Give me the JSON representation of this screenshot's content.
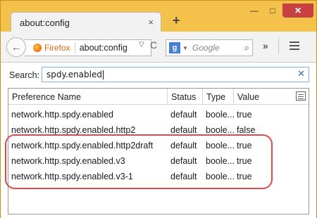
{
  "window": {
    "tab_title": "about:config",
    "tab_close": "×",
    "new_tab": "+",
    "min": "—",
    "max": "□",
    "close": "✕"
  },
  "navbar": {
    "back": "←",
    "identity_label": "Firefox",
    "url": "about:config",
    "dropdown": "▽",
    "reload": "C",
    "search_engine": "g",
    "search_placeholder": "Google",
    "search_icon": "⌕",
    "overflow": "»"
  },
  "config": {
    "search_label": "Search:",
    "search_value": "spdy.enabled",
    "clear": "✕",
    "columns": [
      "Preference Name",
      "Status",
      "Type",
      "Value"
    ],
    "rows": [
      {
        "name": "network.http.spdy.enabled",
        "status": "default",
        "type": "boole...",
        "value": "true"
      },
      {
        "name": "network.http.spdy.enabled.http2",
        "status": "default",
        "type": "boole...",
        "value": "false"
      },
      {
        "name": "network.http.spdy.enabled.http2draft",
        "status": "default",
        "type": "boole...",
        "value": "true"
      },
      {
        "name": "network.http.spdy.enabled.v3",
        "status": "default",
        "type": "boole...",
        "value": "true"
      },
      {
        "name": "network.http.spdy.enabled.v3-1",
        "status": "default",
        "type": "boole...",
        "value": "true"
      }
    ]
  },
  "colors": {
    "chrome_orange": "#f4c24a",
    "highlight_red": "#e04a4a",
    "firefox_label": "#e8630a"
  }
}
